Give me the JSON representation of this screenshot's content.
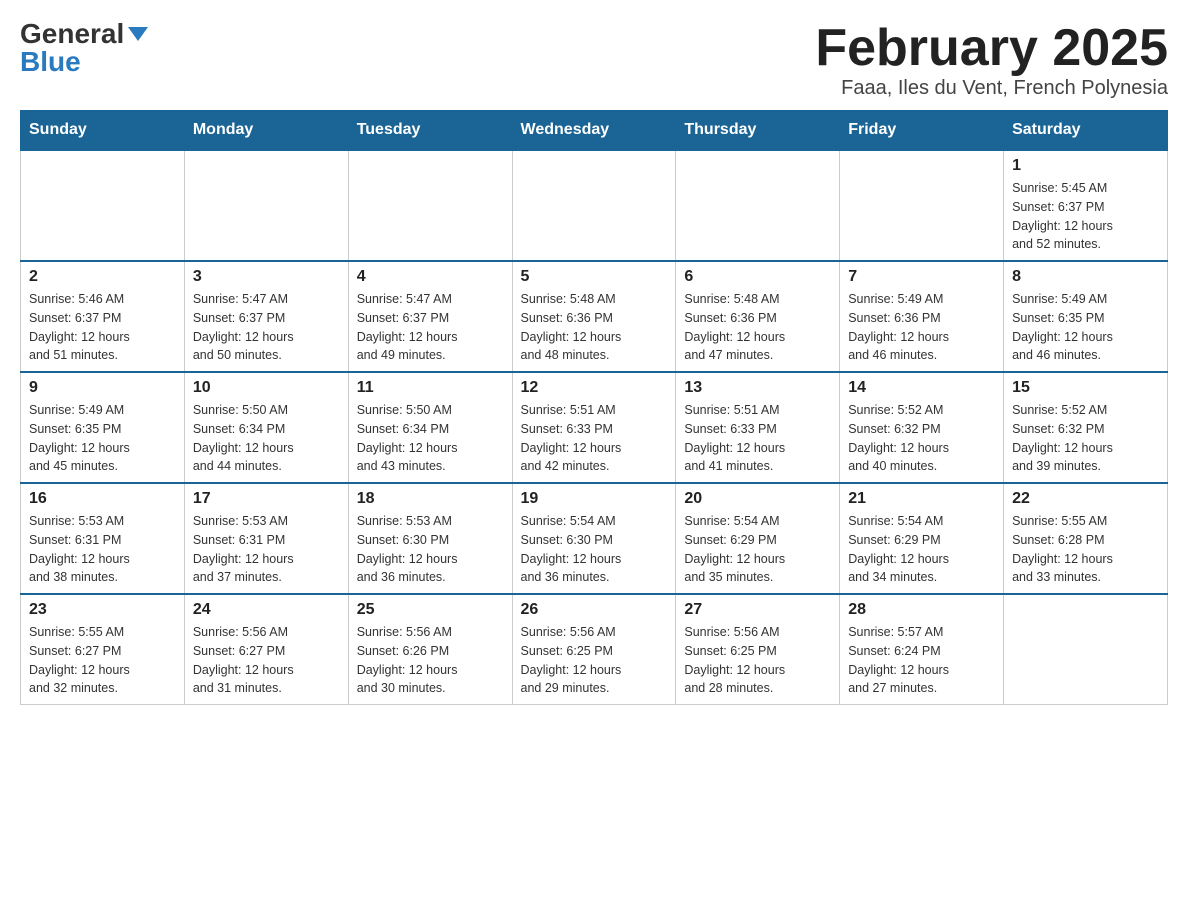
{
  "header": {
    "logo_general": "General",
    "logo_blue": "Blue",
    "title": "February 2025",
    "subtitle": "Faaa, Iles du Vent, French Polynesia"
  },
  "weekdays": [
    "Sunday",
    "Monday",
    "Tuesday",
    "Wednesday",
    "Thursday",
    "Friday",
    "Saturday"
  ],
  "weeks": [
    [
      {
        "day": "",
        "info": ""
      },
      {
        "day": "",
        "info": ""
      },
      {
        "day": "",
        "info": ""
      },
      {
        "day": "",
        "info": ""
      },
      {
        "day": "",
        "info": ""
      },
      {
        "day": "",
        "info": ""
      },
      {
        "day": "1",
        "info": "Sunrise: 5:45 AM\nSunset: 6:37 PM\nDaylight: 12 hours\nand 52 minutes."
      }
    ],
    [
      {
        "day": "2",
        "info": "Sunrise: 5:46 AM\nSunset: 6:37 PM\nDaylight: 12 hours\nand 51 minutes."
      },
      {
        "day": "3",
        "info": "Sunrise: 5:47 AM\nSunset: 6:37 PM\nDaylight: 12 hours\nand 50 minutes."
      },
      {
        "day": "4",
        "info": "Sunrise: 5:47 AM\nSunset: 6:37 PM\nDaylight: 12 hours\nand 49 minutes."
      },
      {
        "day": "5",
        "info": "Sunrise: 5:48 AM\nSunset: 6:36 PM\nDaylight: 12 hours\nand 48 minutes."
      },
      {
        "day": "6",
        "info": "Sunrise: 5:48 AM\nSunset: 6:36 PM\nDaylight: 12 hours\nand 47 minutes."
      },
      {
        "day": "7",
        "info": "Sunrise: 5:49 AM\nSunset: 6:36 PM\nDaylight: 12 hours\nand 46 minutes."
      },
      {
        "day": "8",
        "info": "Sunrise: 5:49 AM\nSunset: 6:35 PM\nDaylight: 12 hours\nand 46 minutes."
      }
    ],
    [
      {
        "day": "9",
        "info": "Sunrise: 5:49 AM\nSunset: 6:35 PM\nDaylight: 12 hours\nand 45 minutes."
      },
      {
        "day": "10",
        "info": "Sunrise: 5:50 AM\nSunset: 6:34 PM\nDaylight: 12 hours\nand 44 minutes."
      },
      {
        "day": "11",
        "info": "Sunrise: 5:50 AM\nSunset: 6:34 PM\nDaylight: 12 hours\nand 43 minutes."
      },
      {
        "day": "12",
        "info": "Sunrise: 5:51 AM\nSunset: 6:33 PM\nDaylight: 12 hours\nand 42 minutes."
      },
      {
        "day": "13",
        "info": "Sunrise: 5:51 AM\nSunset: 6:33 PM\nDaylight: 12 hours\nand 41 minutes."
      },
      {
        "day": "14",
        "info": "Sunrise: 5:52 AM\nSunset: 6:32 PM\nDaylight: 12 hours\nand 40 minutes."
      },
      {
        "day": "15",
        "info": "Sunrise: 5:52 AM\nSunset: 6:32 PM\nDaylight: 12 hours\nand 39 minutes."
      }
    ],
    [
      {
        "day": "16",
        "info": "Sunrise: 5:53 AM\nSunset: 6:31 PM\nDaylight: 12 hours\nand 38 minutes."
      },
      {
        "day": "17",
        "info": "Sunrise: 5:53 AM\nSunset: 6:31 PM\nDaylight: 12 hours\nand 37 minutes."
      },
      {
        "day": "18",
        "info": "Sunrise: 5:53 AM\nSunset: 6:30 PM\nDaylight: 12 hours\nand 36 minutes."
      },
      {
        "day": "19",
        "info": "Sunrise: 5:54 AM\nSunset: 6:30 PM\nDaylight: 12 hours\nand 36 minutes."
      },
      {
        "day": "20",
        "info": "Sunrise: 5:54 AM\nSunset: 6:29 PM\nDaylight: 12 hours\nand 35 minutes."
      },
      {
        "day": "21",
        "info": "Sunrise: 5:54 AM\nSunset: 6:29 PM\nDaylight: 12 hours\nand 34 minutes."
      },
      {
        "day": "22",
        "info": "Sunrise: 5:55 AM\nSunset: 6:28 PM\nDaylight: 12 hours\nand 33 minutes."
      }
    ],
    [
      {
        "day": "23",
        "info": "Sunrise: 5:55 AM\nSunset: 6:27 PM\nDaylight: 12 hours\nand 32 minutes."
      },
      {
        "day": "24",
        "info": "Sunrise: 5:56 AM\nSunset: 6:27 PM\nDaylight: 12 hours\nand 31 minutes."
      },
      {
        "day": "25",
        "info": "Sunrise: 5:56 AM\nSunset: 6:26 PM\nDaylight: 12 hours\nand 30 minutes."
      },
      {
        "day": "26",
        "info": "Sunrise: 5:56 AM\nSunset: 6:25 PM\nDaylight: 12 hours\nand 29 minutes."
      },
      {
        "day": "27",
        "info": "Sunrise: 5:56 AM\nSunset: 6:25 PM\nDaylight: 12 hours\nand 28 minutes."
      },
      {
        "day": "28",
        "info": "Sunrise: 5:57 AM\nSunset: 6:24 PM\nDaylight: 12 hours\nand 27 minutes."
      },
      {
        "day": "",
        "info": ""
      }
    ]
  ]
}
